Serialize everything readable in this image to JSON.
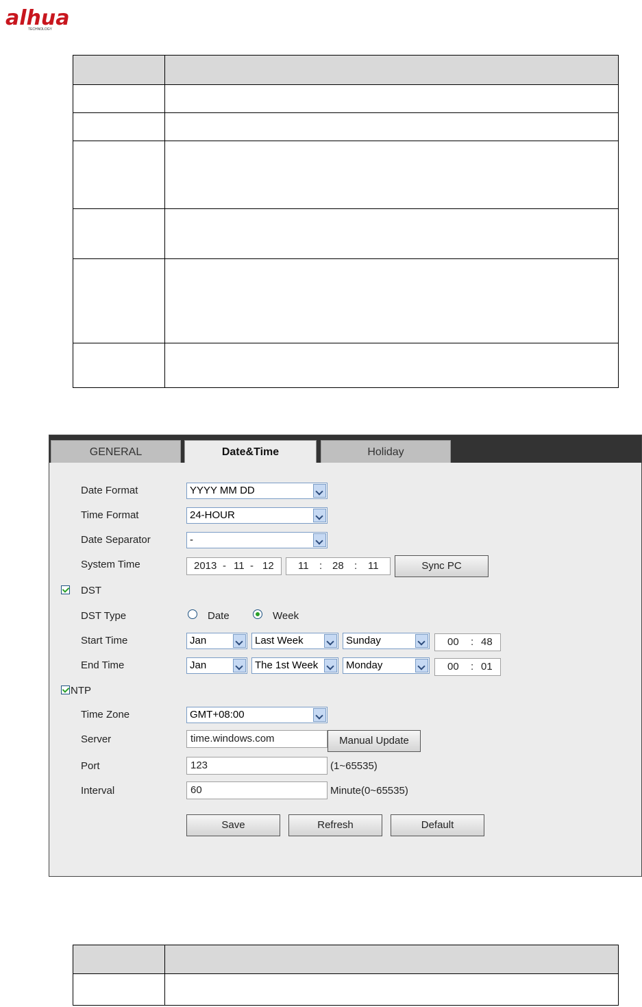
{
  "logo": {
    "brand": "alhua",
    "tagline": "TECHNOLOGY"
  },
  "tabs": [
    {
      "label": "GENERAL"
    },
    {
      "label": "Date&Time"
    },
    {
      "label": "Holiday"
    }
  ],
  "form": {
    "date_format": {
      "label": "Date Format",
      "value": "YYYY MM DD"
    },
    "time_format": {
      "label": "Time Format",
      "value": "24-HOUR"
    },
    "date_separator": {
      "label": "Date Separator",
      "value": "-"
    },
    "system_time": {
      "label": "System Time",
      "date": {
        "year": "2013",
        "month": "11",
        "day": "12",
        "sep": "-"
      },
      "time": {
        "hour": "11",
        "minute": "28",
        "second": "11",
        "sep": ":"
      },
      "sync_label": "Sync PC"
    },
    "dst": {
      "label": "DST",
      "checked": true
    },
    "dst_type": {
      "label": "DST Type",
      "date_label": "Date",
      "week_label": "Week",
      "selected": "Week"
    },
    "start_time": {
      "label": "Start Time",
      "month": "Jan",
      "week": "Last Week",
      "day": "Sunday",
      "hour": "00",
      "minute": "48"
    },
    "end_time": {
      "label": "End Time",
      "month": "Jan",
      "week": "The 1st Week",
      "day": "Monday",
      "hour": "00",
      "minute": "01"
    },
    "ntp": {
      "label": "NTP",
      "checked": true
    },
    "time_zone": {
      "label": "Time Zone",
      "value": "GMT+08:00"
    },
    "server": {
      "label": "Server",
      "value": "time.windows.com",
      "button": "Manual Update"
    },
    "port": {
      "label": "Port",
      "value": "123",
      "hint": "(1~65535)"
    },
    "interval": {
      "label": "Interval",
      "value": "60",
      "hint": "Minute(0~65535)"
    }
  },
  "buttons": {
    "save": "Save",
    "refresh": "Refresh",
    "default": "Default"
  }
}
